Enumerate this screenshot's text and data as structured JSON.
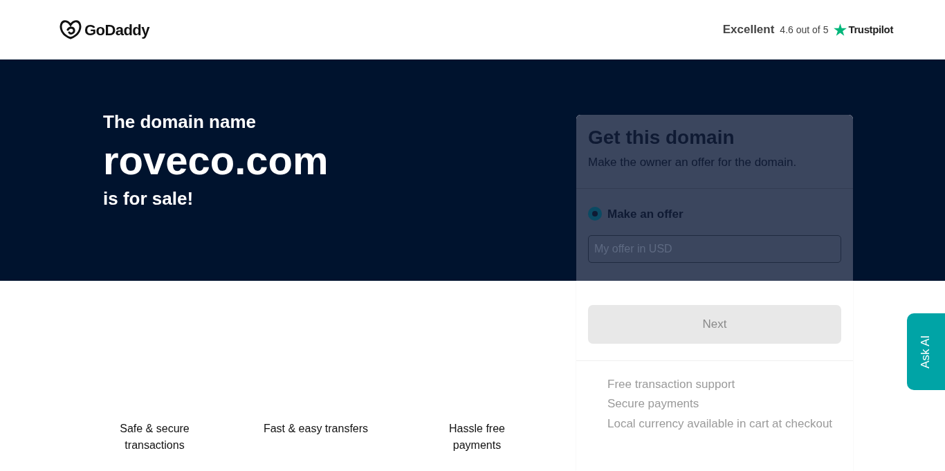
{
  "header": {
    "logo": "GoDaddy",
    "rating_label": "Excellent",
    "rating_score": "4.6 out of 5",
    "rating_brand": "Trustpilot"
  },
  "hero": {
    "intro": "The domain name",
    "domain": "roveco.com",
    "outro": "is for sale!"
  },
  "features": [
    "Safe & secure transactions",
    "Fast & easy transfers",
    "Hassle free payments"
  ],
  "offer_card": {
    "title": "Get this domain",
    "subtitle": "Make the owner an offer for the domain.",
    "options": [
      {
        "label": "Make an offer",
        "selected": true
      }
    ],
    "offer_field": {
      "placeholder": "My offer in USD"
    },
    "next_button": {
      "label": "Next",
      "disabled": true
    },
    "benefits": [
      "Free transaction support",
      "Secure payments",
      "Local currency available in cart at checkout"
    ]
  },
  "ask_ai": {
    "label": "Ask AI"
  }
}
